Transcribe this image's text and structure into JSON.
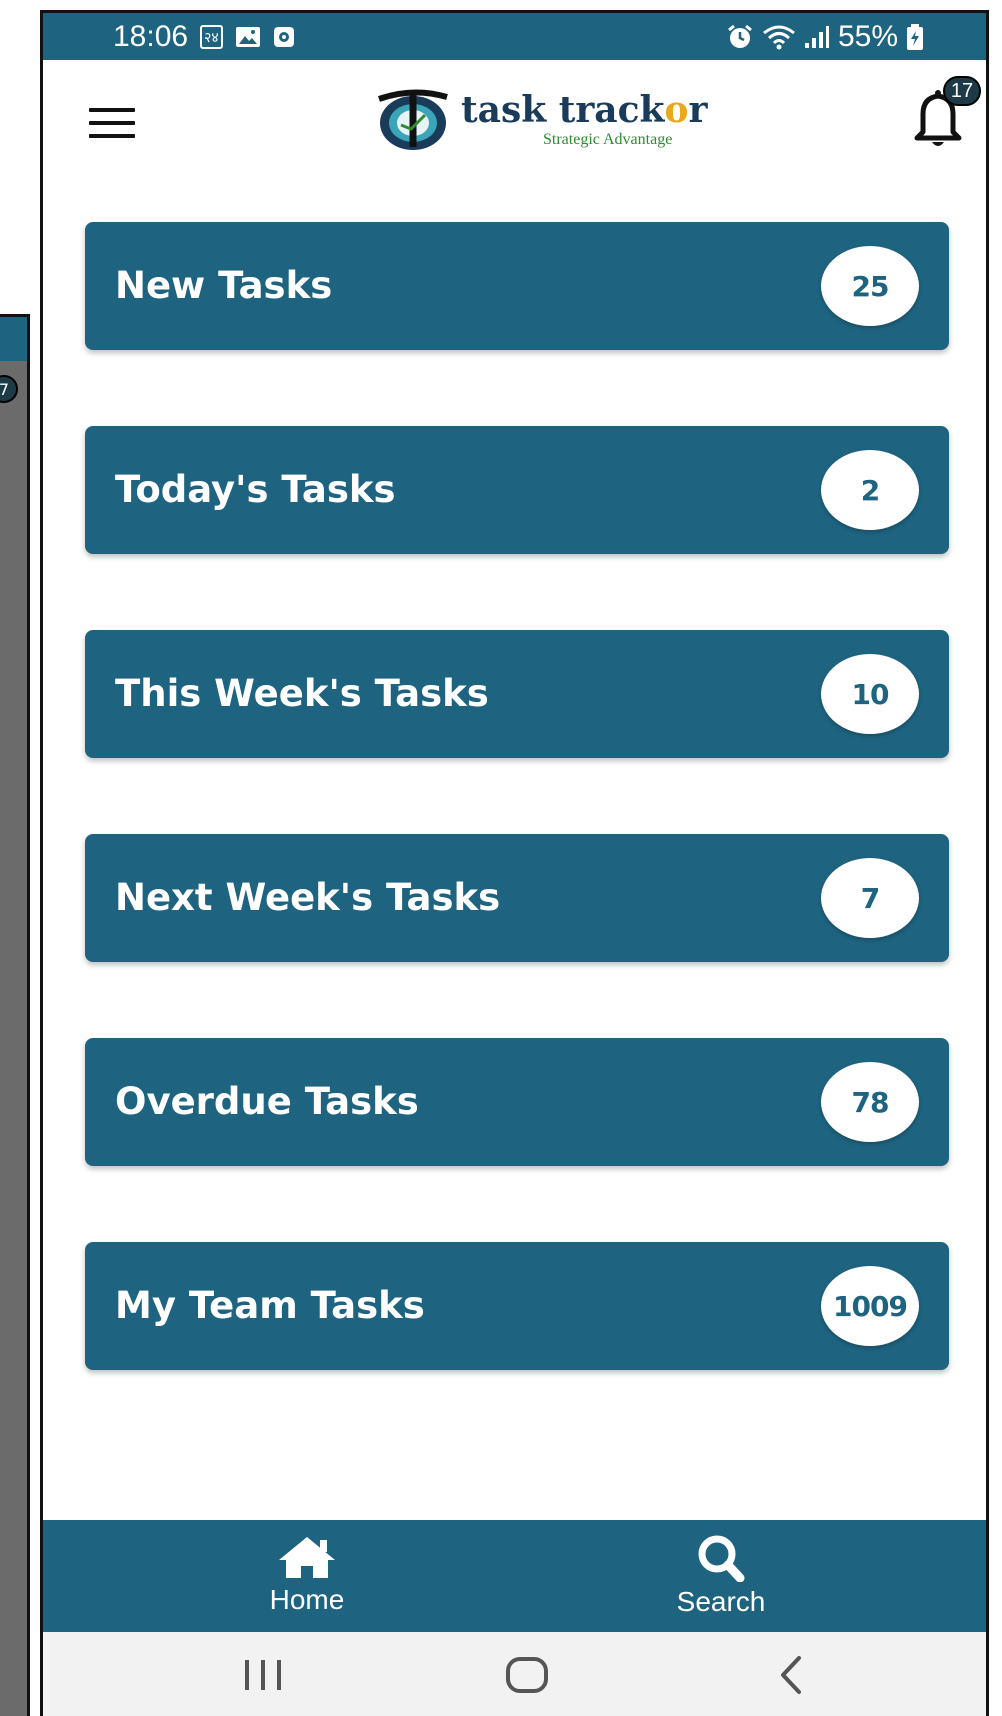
{
  "status_bar": {
    "time": "18:06",
    "left_badge": "२४",
    "battery": "55%"
  },
  "header": {
    "logo_main_prefix": "task track",
    "logo_main_o": "o",
    "logo_main_suffix": "r",
    "logo_sub": "Strategic Advantage",
    "notification_count": "17"
  },
  "background_window": {
    "badge_partial": "7"
  },
  "tasks": [
    {
      "label": "New Tasks",
      "count": "25"
    },
    {
      "label": "Today's Tasks",
      "count": "2"
    },
    {
      "label": "This Week's Tasks",
      "count": "10"
    },
    {
      "label": "Next Week's Tasks",
      "count": "7"
    },
    {
      "label": "Overdue Tasks",
      "count": "78"
    },
    {
      "label": "My Team Tasks",
      "count": "1009"
    }
  ],
  "bottom_nav": {
    "home_label": "Home",
    "search_label": "Search"
  },
  "colors": {
    "primary": "#1e6480",
    "badge_bg": "#1c3b47",
    "logo_text": "#1b3b5a",
    "logo_accent": "#e8a91c",
    "logo_sub": "#2e8b2e"
  }
}
